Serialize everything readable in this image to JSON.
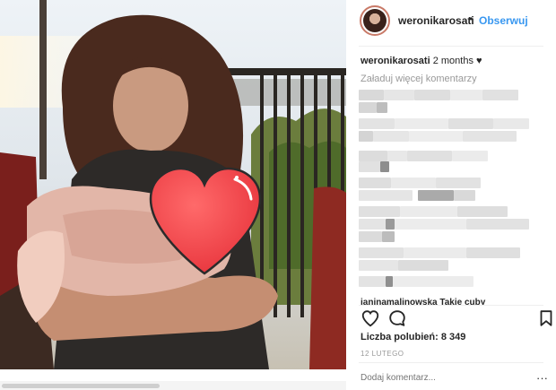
{
  "post": {
    "username": "weronikarosati",
    "follow_label": "Obserwuj",
    "separator": "•",
    "caption": {
      "username": "weronikarosati",
      "time": "2 months",
      "emoji": "♥"
    },
    "load_more": "Załaduj więcej komentarzy",
    "partial_comment": "janinamalinowska Takie cuby",
    "likes_label": "Liczba polubień:",
    "likes_count": "8 349",
    "date": "12 LUTEGO",
    "add_comment_placeholder": "Dodaj komentarz...",
    "more_icon": "···"
  },
  "icons": {
    "like": "heart-outline-icon",
    "comment": "speech-bubble-icon",
    "save": "bookmark-icon",
    "overlay": "red-heart-sticker"
  },
  "colors": {
    "follow": "#3897f0",
    "heart": "#f0434a",
    "muted": "#999999"
  }
}
